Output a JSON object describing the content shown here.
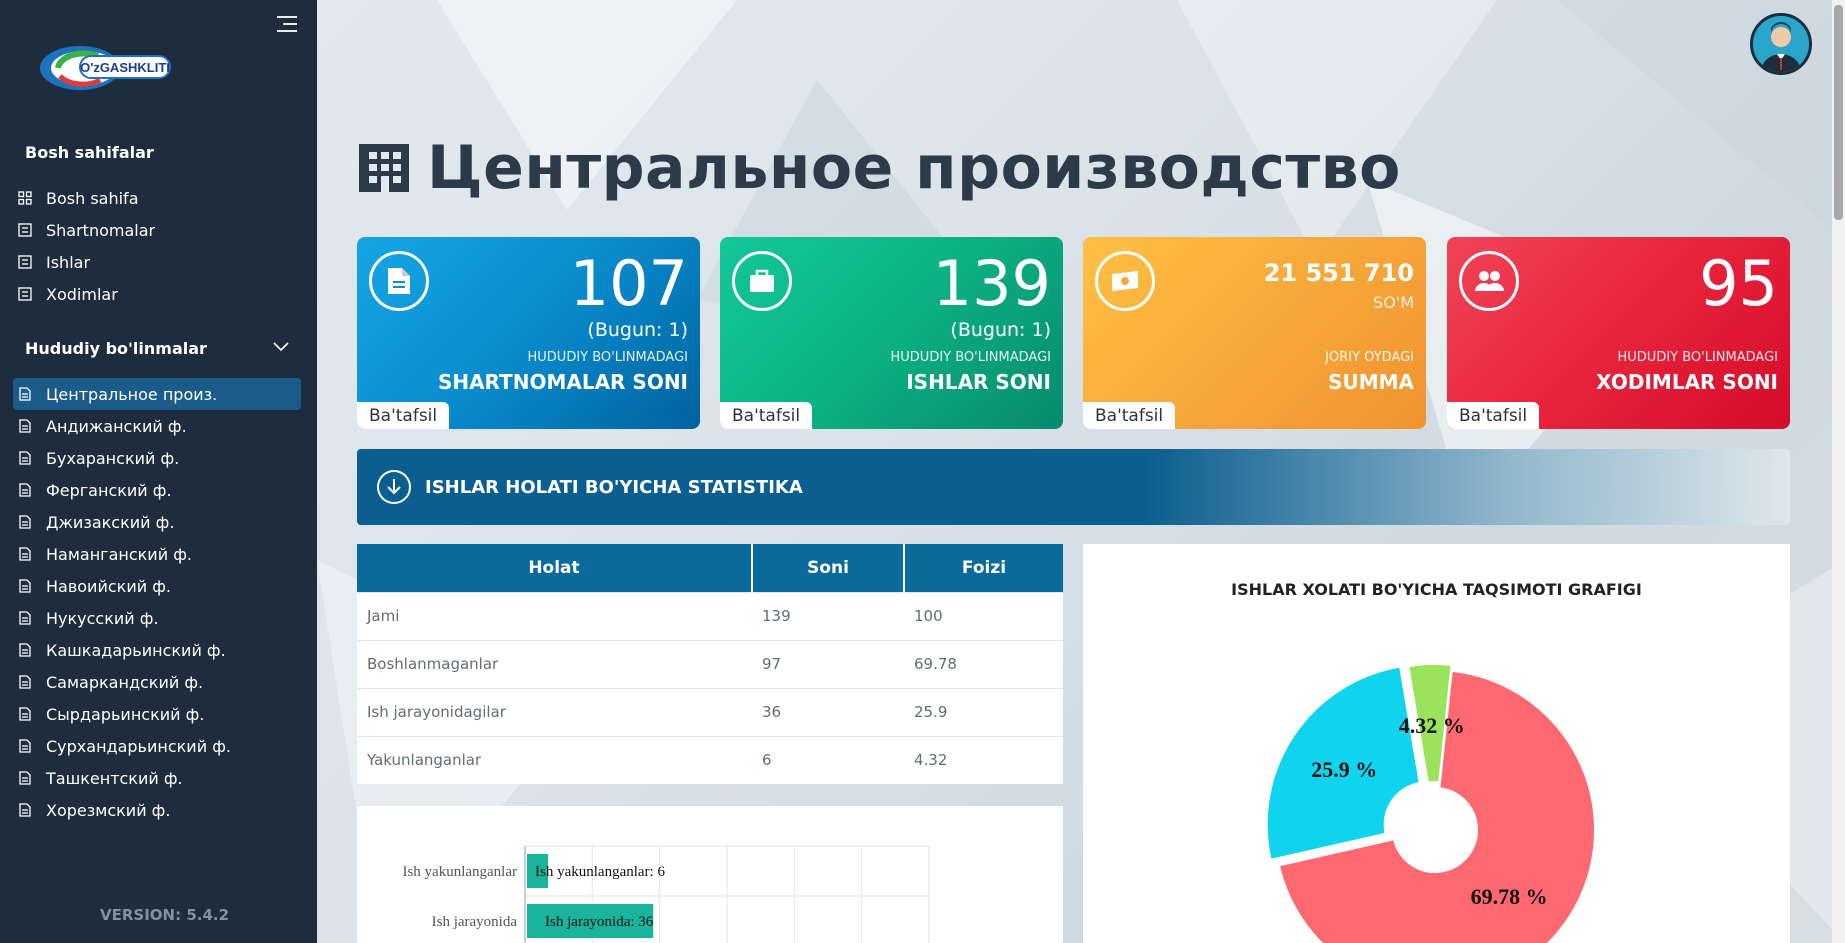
{
  "app": {
    "logo_text": "O'zGASHKLITI",
    "version": "VERSION: 5.4.2"
  },
  "sidebar": {
    "section1_title": "Bosh sahifalar",
    "items": [
      {
        "label": "Bosh sahifa",
        "icon": "grid-icon"
      },
      {
        "label": "Shartnomalar",
        "icon": "list-icon"
      },
      {
        "label": "Ishlar",
        "icon": "list-icon"
      },
      {
        "label": "Xodimlar",
        "icon": "list-icon"
      }
    ],
    "section2_title": "Hududiy bo'linmalar",
    "regions": [
      {
        "label": "Центральное произ.",
        "active": true
      },
      {
        "label": "Андижанский ф."
      },
      {
        "label": "Бухаранский ф."
      },
      {
        "label": "Ферганский ф."
      },
      {
        "label": "Джизакский ф."
      },
      {
        "label": "Наманганский ф."
      },
      {
        "label": "Навоийский ф."
      },
      {
        "label": "Нукусский ф."
      },
      {
        "label": "Кашкадарьинский ф."
      },
      {
        "label": "Самаркандский ф."
      },
      {
        "label": "Сырдарьинский ф."
      },
      {
        "label": "Сурхандарьинский ф."
      },
      {
        "label": "Ташкентский ф."
      },
      {
        "label": "Хорезмский ф."
      }
    ]
  },
  "page": {
    "title": "Центральное производство"
  },
  "cards": [
    {
      "value": "107",
      "today": "(Bugun: 1)",
      "sub": "HUDUDIY BO'LINMADAGI",
      "label": "SHARTNOMALAR SONI",
      "more": "Ba'tafsil",
      "color": "#0a8fd0"
    },
    {
      "value": "139",
      "today": "(Bugun: 1)",
      "sub": "HUDUDIY BO'LINMADAGI",
      "label": "ISHLAR SONI",
      "more": "Ba'tafsil",
      "color": "#0cb486"
    },
    {
      "value": "21 551 710",
      "unit": "SO'M",
      "sub": "JORIY OYDAGI",
      "label": "SUMMA",
      "more": "Ba'tafsil",
      "color": "#f7a93a"
    },
    {
      "value": "95",
      "sub": "HUDUDIY BO'LINMADAGI",
      "label": "XODIMLAR SONI",
      "more": "Ba'tafsil",
      "color": "#e8243c"
    }
  ],
  "stats_section": {
    "title": "ISHLAR HOLATI BO'YICHA STATISTIKA"
  },
  "table": {
    "headers": [
      "Holat",
      "Soni",
      "Foizi"
    ],
    "rows": [
      [
        "Jami",
        "139",
        "100"
      ],
      [
        "Boshlanmaganlar",
        "97",
        "69.78"
      ],
      [
        "Ish jarayonidagilar",
        "36",
        "25.9"
      ],
      [
        "Yakunlanganlar",
        "6",
        "4.32"
      ]
    ]
  },
  "chart_data": [
    {
      "type": "bar",
      "orientation": "horizontal",
      "categories": [
        "Ish yakunlanganlar",
        "Ish jarayonida"
      ],
      "values": [
        6,
        36
      ],
      "data_labels": [
        "Ish yakunlanganlar: 6",
        "Ish jarayonida: 36"
      ],
      "colors": [
        "#1ab39c",
        "#1ab39c"
      ],
      "grid": true
    },
    {
      "type": "pie",
      "title": "ISHLAR XOLATI BO'YICHA TAQSIMOTI GRAFIGI",
      "donut": true,
      "slices": [
        {
          "value": 69.78,
          "label": "69.78 %",
          "color": "#fe6870"
        },
        {
          "value": 25.9,
          "label": "25.9 %",
          "color": "#10d4ee"
        },
        {
          "value": 4.32,
          "label": "4.32 %",
          "color": "#9be35a"
        }
      ]
    }
  ]
}
